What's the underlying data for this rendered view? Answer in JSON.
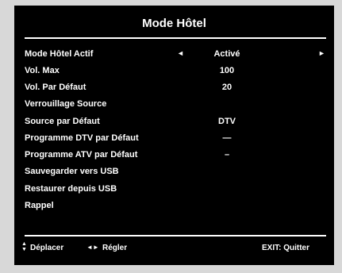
{
  "menu": {
    "title": "Mode Hôtel",
    "items": [
      {
        "label": "Mode Hôtel Actif",
        "value": "Activé",
        "has_arrows": true
      },
      {
        "label": "Vol. Max",
        "value": "100"
      },
      {
        "label": "Vol. Par Défaut",
        "value": "20"
      },
      {
        "label": "Verrouillage Source",
        "value": ""
      },
      {
        "label": "Source par Défaut",
        "value": "DTV"
      },
      {
        "label": "Programme DTV par Défaut",
        "value": "—"
      },
      {
        "label": "Programme ATV par Défaut",
        "value": "–"
      },
      {
        "label": "Sauvegarder vers USB",
        "value": ""
      },
      {
        "label": "Restaurer depuis USB",
        "value": ""
      },
      {
        "label": "Rappel",
        "value": ""
      }
    ],
    "arrow_left": "◄",
    "arrow_right": "►"
  },
  "footer": {
    "move_icon_up": "▲",
    "move_icon_down": "▼",
    "move_label": "Déplacer",
    "adjust_icon": "◄►",
    "adjust_label": "Régler",
    "exit_label": "EXIT: Quitter"
  },
  "colors": {
    "background": "#000000",
    "text": "#ffffff",
    "outer": "#d8d8d8"
  }
}
